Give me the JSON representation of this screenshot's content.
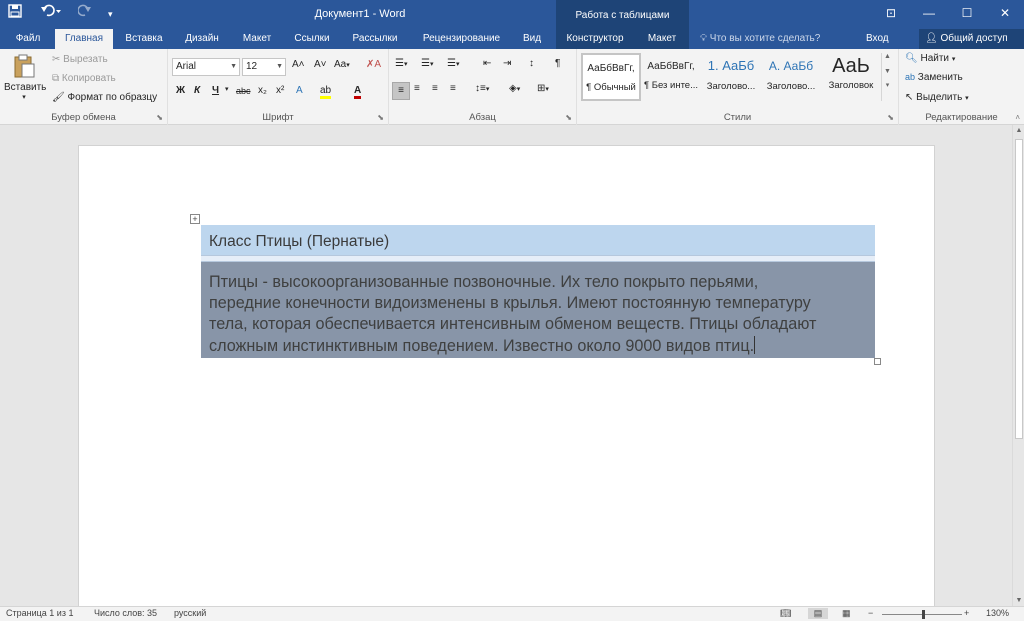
{
  "app": {
    "title": "Документ1 - Word",
    "context_group": "Работа с таблицами"
  },
  "qat": {
    "save_icon": "save-icon",
    "undo_icon": "undo-icon",
    "redo_icon": "redo-icon",
    "customize_icon": "customize-icon"
  },
  "window": {
    "ribbon_options_glyph": "⊡",
    "minimize_glyph": "—",
    "maximize_glyph": "☐",
    "close_glyph": "✕"
  },
  "tabs": [
    "Файл",
    "Главная",
    "Вставка",
    "Дизайн",
    "Макет",
    "Ссылки",
    "Рассылки",
    "Рецензирование",
    "Вид",
    "Конструктор",
    "Макет"
  ],
  "tellme": "Что вы хотите сделать?",
  "signin": "Вход",
  "share": "Общий доступ",
  "ribbon": {
    "clipboard": {
      "label": "Буфер обмена",
      "paste": "Вставить",
      "cut": "Вырезать",
      "copy": "Копировать",
      "format_painter": "Формат по образцу"
    },
    "font": {
      "label": "Шрифт",
      "font_name": "Arial",
      "font_size": "12",
      "bold": "Ж",
      "italic": "К",
      "underline": "Ч",
      "strike": "abc",
      "subscript": "x₂",
      "superscript": "x²",
      "grow": "A˄",
      "shrink": "A˅",
      "case": "Aa",
      "clear_glyph": "✗A",
      "effects_glyph": "A",
      "highlight_glyph": "ab",
      "font_color_glyph": "A"
    },
    "paragraph": {
      "label": "Абзац",
      "pilcrow": "¶"
    },
    "styles": {
      "label": "Стили",
      "items": [
        {
          "sample": "АаБбВвГг,",
          "name": "¶ Обычный"
        },
        {
          "sample": "АаБбВвГг,",
          "name": "¶ Без инте..."
        },
        {
          "sample": "1. АаБб",
          "name": "Заголово..."
        },
        {
          "sample": "А. АаБб",
          "name": "Заголово..."
        },
        {
          "sample": "АаЬ",
          "name": "Заголовок"
        }
      ]
    },
    "editing": {
      "label": "Редактирование",
      "find": "Найти",
      "replace": "Заменить",
      "select": "Выделить"
    }
  },
  "document": {
    "heading": "Класс Птицы (Пернатые)",
    "body_lines": [
      "Птицы - высокоорганизованные позвоночные. Их тело покрыто перьями,",
      "передние конечности видоизменены в крылья. Имеют постоянную температуру",
      "тела, которая обеспечивается интенсивным обменом веществ. Птицы обладают",
      "сложным инстинктивным поведением. Известно около 9000 видов птиц."
    ]
  },
  "status": {
    "page": "Страница 1 из 1",
    "words": "Число слов: 35",
    "language": "русский",
    "zoom_minus": "−",
    "zoom_plus": "+",
    "zoom": "130%"
  },
  "colors": {
    "title_bar": "#2b579a",
    "context_tab": "#1e4477",
    "table_header": "#bdd6ee",
    "table_body_selected": "#8895a8"
  }
}
